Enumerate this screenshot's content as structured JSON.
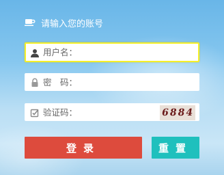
{
  "header": {
    "title": "请输入您的账号",
    "icon": "cup-icon"
  },
  "form": {
    "username": {
      "placeholder": "用户名：",
      "value": "",
      "icon": "user-icon"
    },
    "password": {
      "placeholder": "密　码：",
      "value": "",
      "icon": "lock-icon"
    },
    "captcha": {
      "placeholder": "验证码：",
      "value": "",
      "icon": "edit-check-icon",
      "image_text": "6884"
    }
  },
  "buttons": {
    "login": "登录",
    "reset": "重置"
  },
  "colors": {
    "login_button": "#dd4b3d",
    "reset_button": "#1fc0bd",
    "focus_border": "#f5ef2a"
  }
}
